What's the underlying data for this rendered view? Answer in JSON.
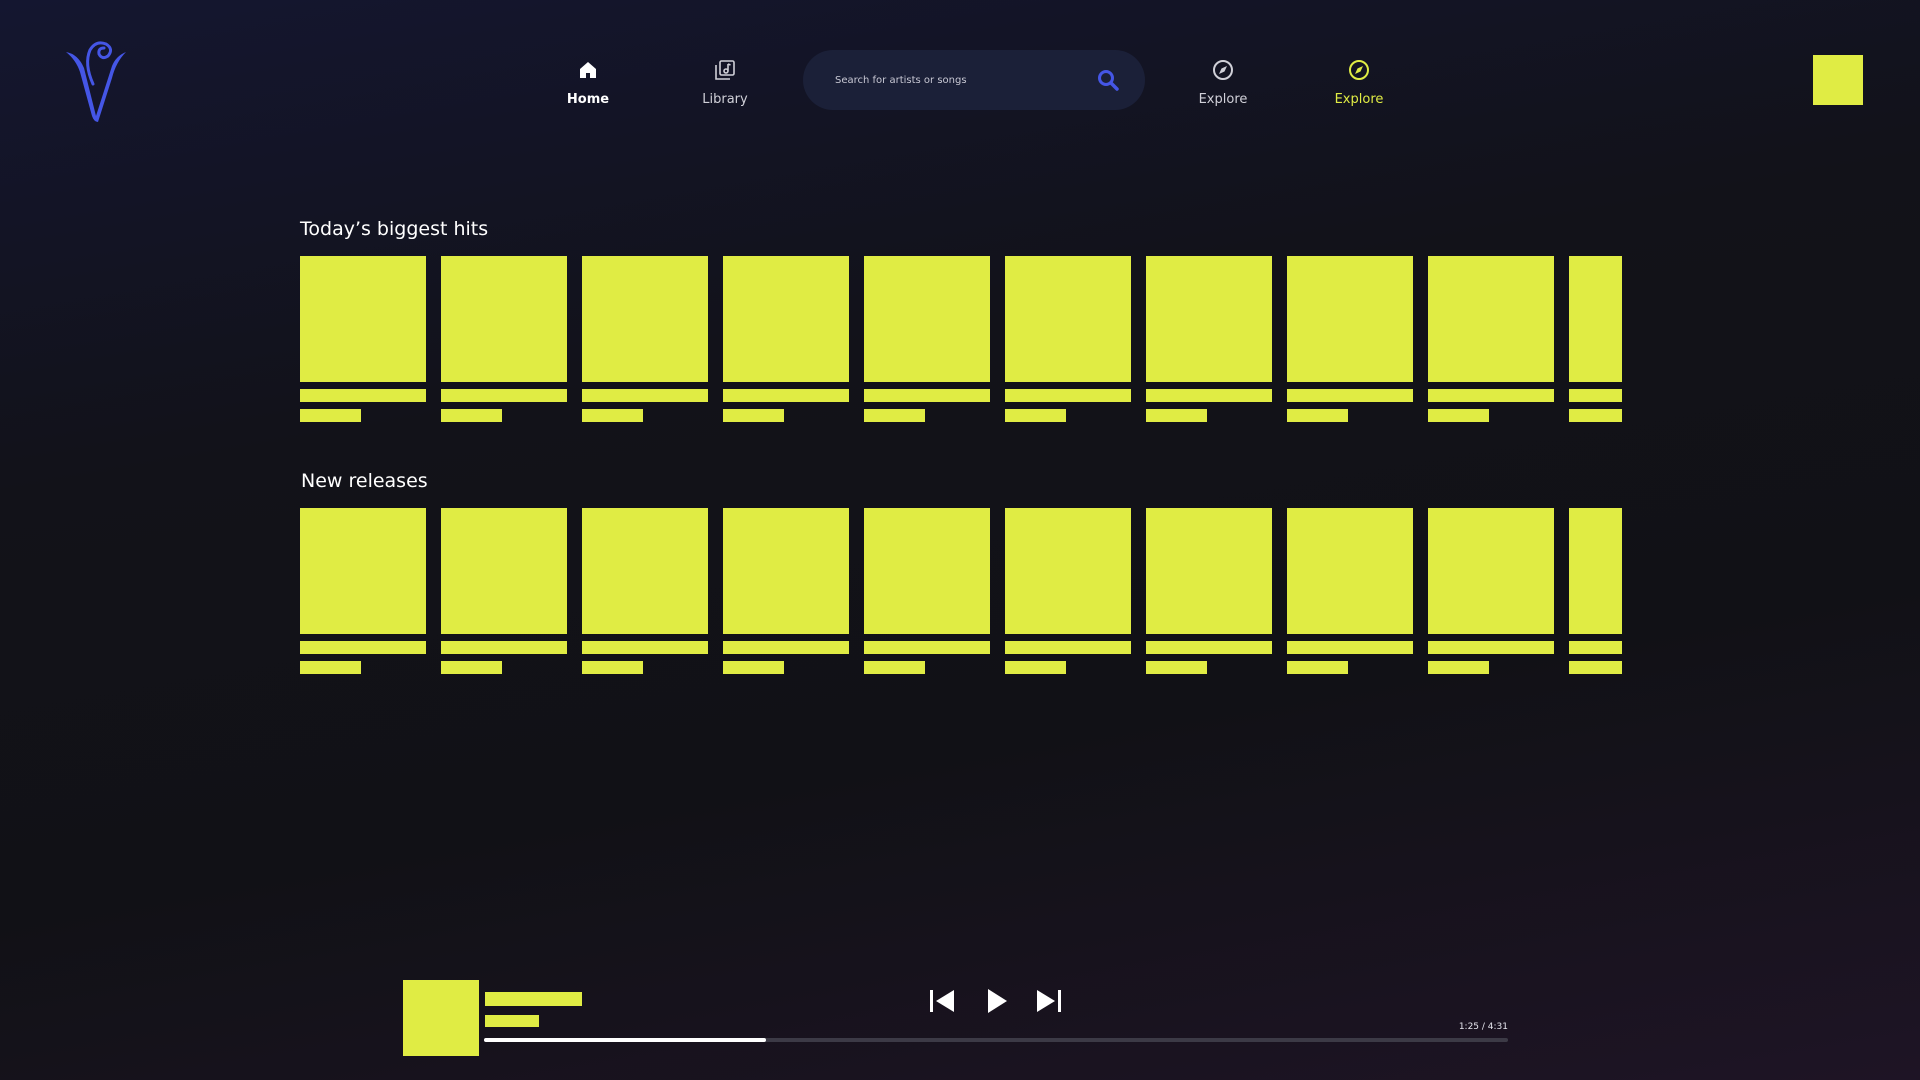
{
  "header": {
    "nav": [
      {
        "label": "Home",
        "icon": "home-icon",
        "state": "active"
      },
      {
        "label": "Library",
        "icon": "library-icon",
        "state": "normal"
      },
      {
        "label": "Explore",
        "icon": "compass-icon",
        "state": "normal"
      },
      {
        "label": "Explore",
        "icon": "compass-icon",
        "state": "highlight"
      }
    ],
    "search": {
      "placeholder": "Search for artists or songs",
      "icon": "search-icon"
    }
  },
  "sections": [
    {
      "title": "Today’s biggest hits",
      "card_count": 10
    },
    {
      "title": "New releases",
      "card_count": 10
    }
  ],
  "player": {
    "time": "1:25 / 4:31",
    "progress": 0.275,
    "controls": [
      "skip-previous-icon",
      "play-icon",
      "skip-next-icon"
    ]
  },
  "colors": {
    "accent": "#e0ec44",
    "logo": "#4556e6",
    "search_icon": "#4556e6",
    "search_bg": "#1b2038"
  }
}
